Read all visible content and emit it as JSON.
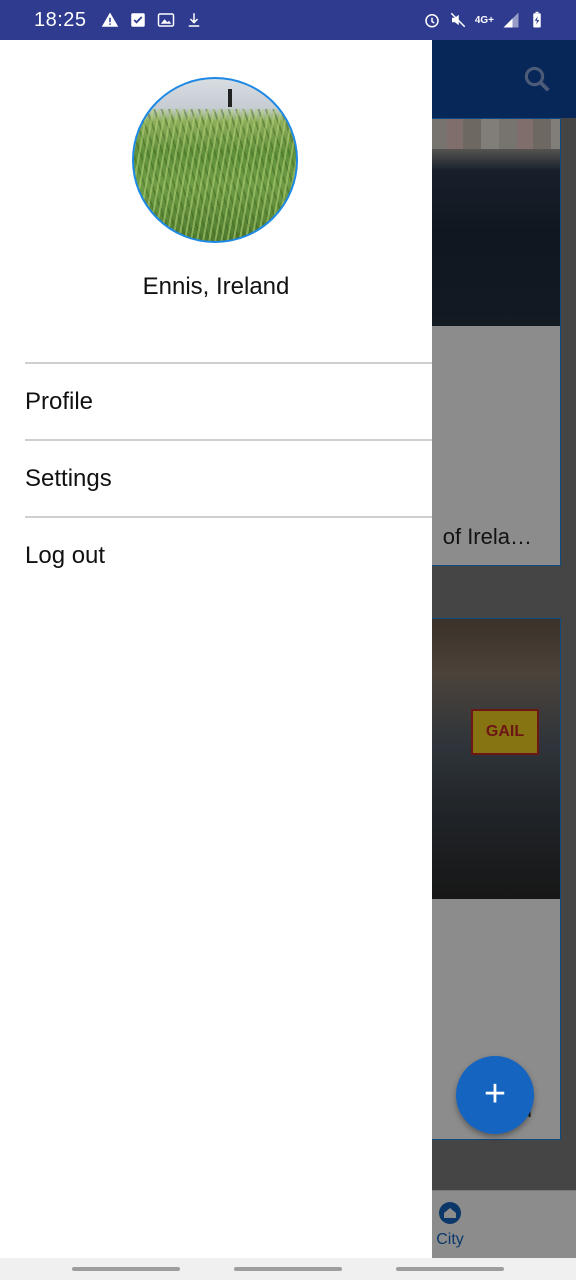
{
  "status_bar": {
    "time": "18:25",
    "left_icons": [
      "warning-icon",
      "checkbox-icon",
      "image-icon",
      "download-icon"
    ],
    "right_icons": [
      "alarm-icon",
      "mute-icon",
      "network-icon",
      "signal-icon",
      "battery-icon"
    ],
    "network_label": "4G+"
  },
  "app_bar": {
    "color": "#0d47a1",
    "action_icon": "search-icon"
  },
  "cards": [
    {
      "title": "of Irela…"
    },
    {
      "title": "and",
      "sign_text": "GAIL"
    }
  ],
  "fab": {
    "label": "+"
  },
  "bottom_nav": {
    "city_label": "City"
  },
  "drawer": {
    "location": "Ennis, Ireland",
    "menu": [
      {
        "label": "Profile"
      },
      {
        "label": "Settings"
      },
      {
        "label": "Log out"
      }
    ]
  },
  "colors": {
    "accent": "#1e88e5",
    "status_bar": "#2f3b8f"
  }
}
